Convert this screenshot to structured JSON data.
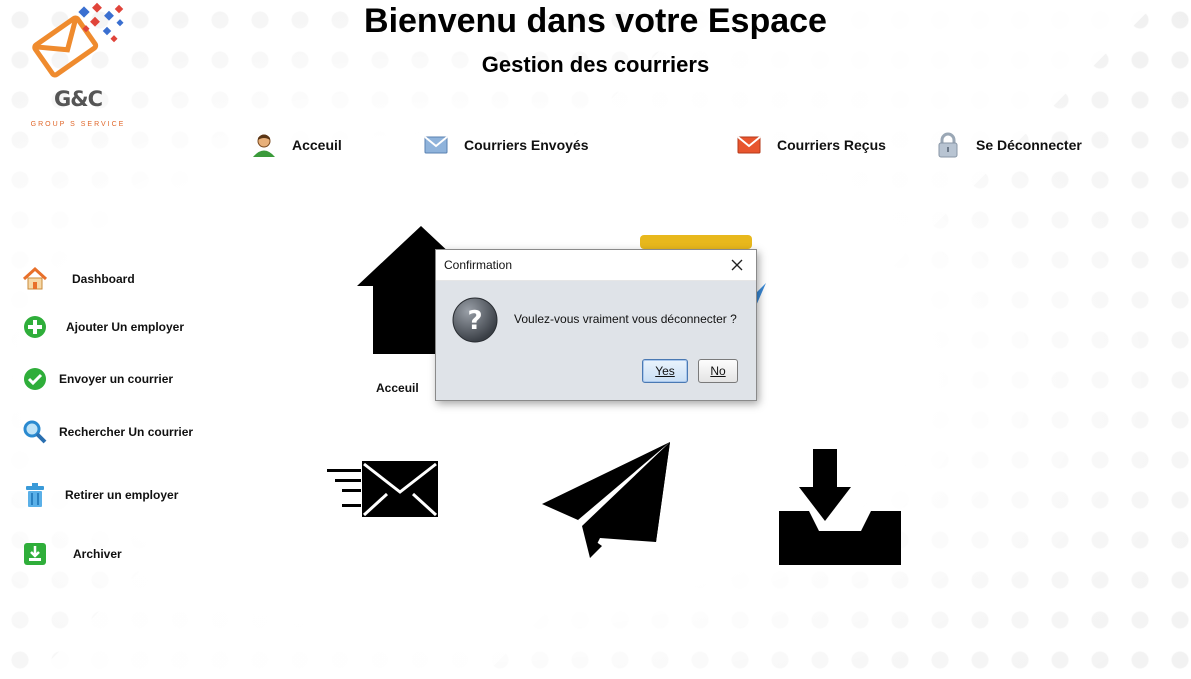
{
  "header": {
    "title": "Bienvenu dans votre Espace",
    "subtitle": "Gestion des courriers"
  },
  "logo": {
    "text": "G&C",
    "tagline": "GROUP S SERVICE"
  },
  "topnav": [
    {
      "label": "Acceuil",
      "icon": "user-icon"
    },
    {
      "label": "Courriers Envoyés",
      "icon": "mail-icon"
    },
    {
      "label": "Courriers Reçus",
      "icon": "mail-received-icon"
    },
    {
      "label": "Se Déconnecter",
      "icon": "lock-icon"
    }
  ],
  "sidebar": [
    {
      "label": "Dashboard",
      "icon": "home-icon"
    },
    {
      "label": "Ajouter Un employer",
      "icon": "plus-icon"
    },
    {
      "label": "Envoyer un courrier",
      "icon": "check-icon"
    },
    {
      "label": "Rechercher Un courrier",
      "icon": "search-icon"
    },
    {
      "label": "Retirer un employer",
      "icon": "trash-icon"
    },
    {
      "label": "Archiver",
      "icon": "download-icon"
    }
  ],
  "main": {
    "home_caption": "Acceuil"
  },
  "dialog": {
    "title": "Confirmation",
    "message": "Voulez-vous vraiment vous déconnecter ?",
    "yes_label": "Yes",
    "no_label": "No"
  },
  "colors": {
    "logo_orange": "#ef8b2e",
    "logo_blue": "#3a6fd0",
    "logo_red": "#e0443a",
    "dialog_body": "#dfe3e8"
  }
}
